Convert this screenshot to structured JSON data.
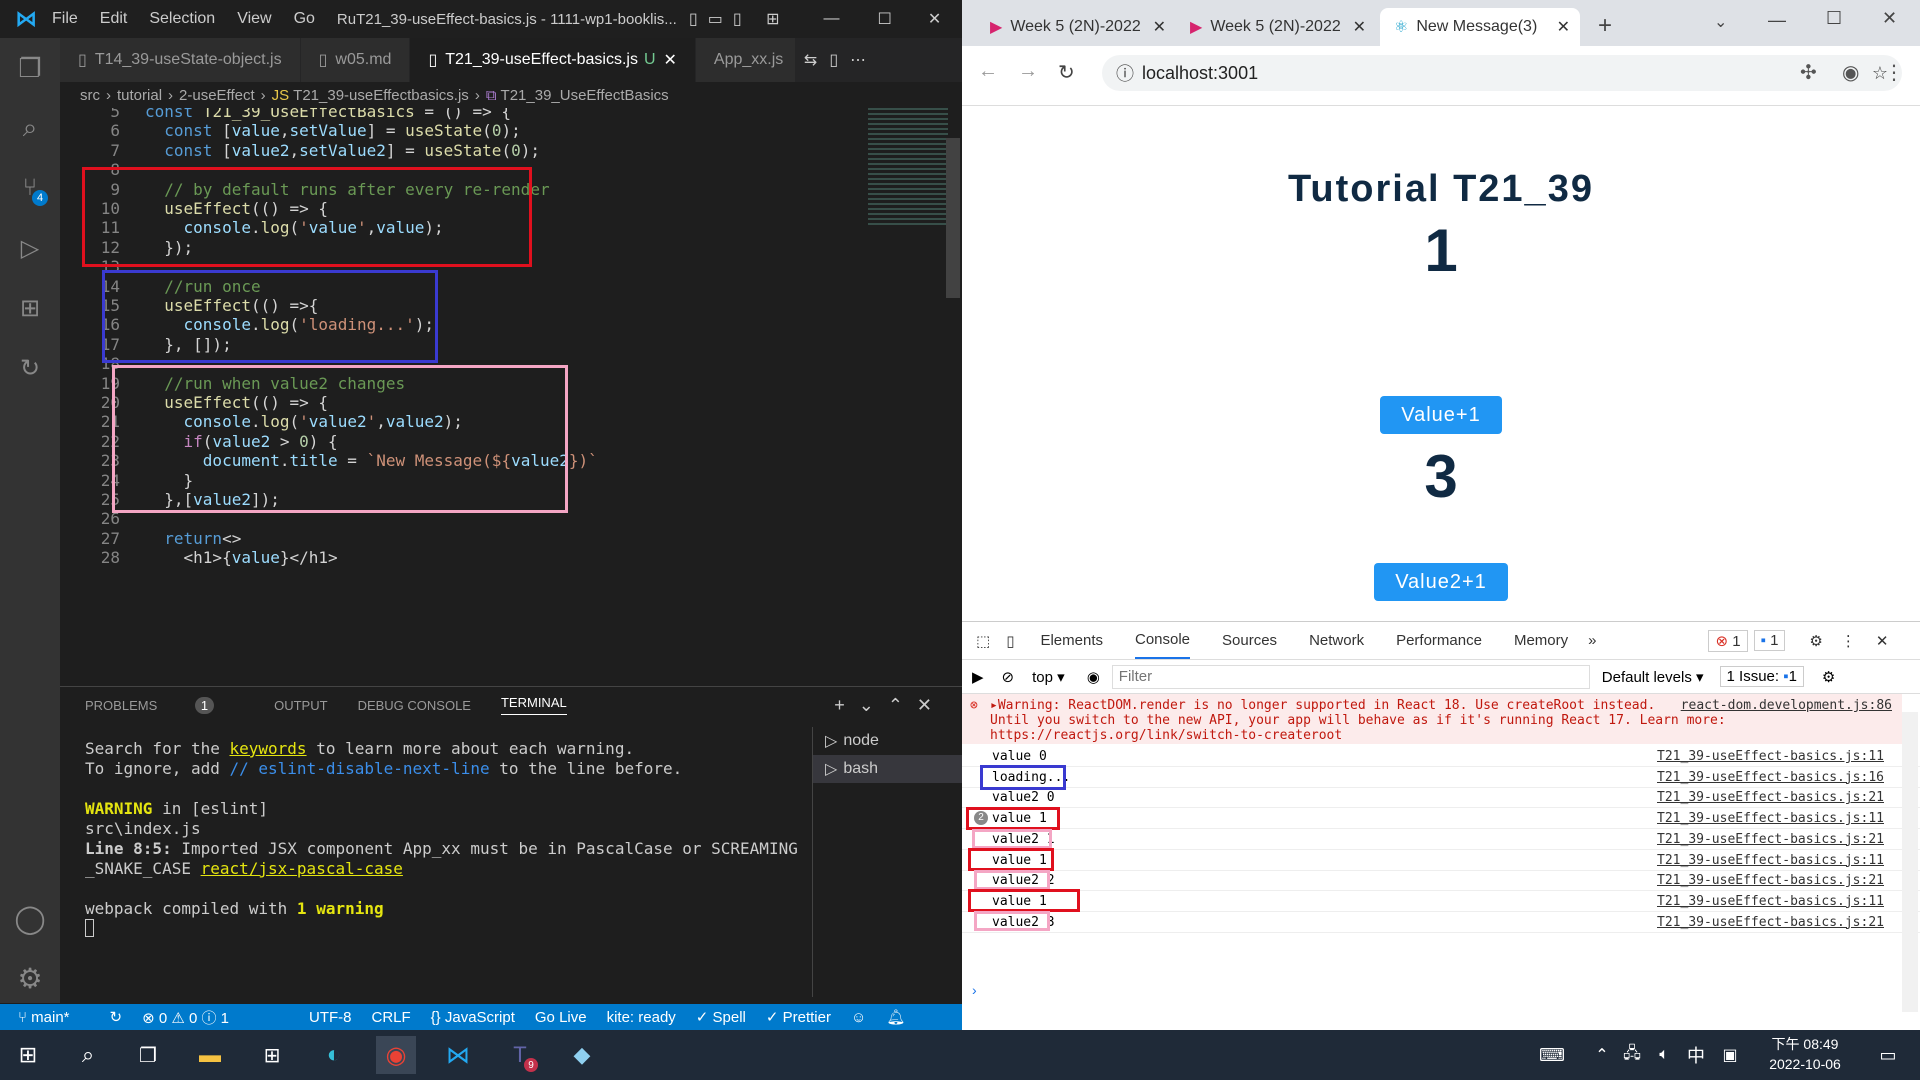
{
  "vscode": {
    "menu": [
      "File",
      "Edit",
      "Selection",
      "View",
      "Go"
    ],
    "title": "RuT21_39-useEffect-basics.js - 1111-wp1-booklis...",
    "tabs": [
      "T14_39-useState-object.js",
      "w05.md",
      "T21_39-useEffect-basics.js",
      "App_xx.js"
    ],
    "active_tab_marker": "U",
    "breadcrumb": [
      "src",
      "tutorial",
      "2-useEffect",
      "T21_39-useEffectbasics.js",
      "T21_39_UseEffectBasics"
    ],
    "badge_source_control": "4",
    "code": [
      {
        "n": "5",
        "t": "const T21_39_UseEffectBasics = () => {"
      },
      {
        "n": "6",
        "t": "  const [value,setValue] = useState(0);"
      },
      {
        "n": "7",
        "t": "  const [value2,setValue2] = useState(0);"
      },
      {
        "n": "8",
        "t": ""
      },
      {
        "n": "9",
        "t": "  // by default runs after every re-render"
      },
      {
        "n": "10",
        "t": "  useEffect(() => {"
      },
      {
        "n": "11",
        "t": "    console.log('value',value);"
      },
      {
        "n": "12",
        "t": "  });"
      },
      {
        "n": "13",
        "t": ""
      },
      {
        "n": "14",
        "t": "  //run once"
      },
      {
        "n": "15",
        "t": "  useEffect(() =>{"
      },
      {
        "n": "16",
        "t": "    console.log('loading...');"
      },
      {
        "n": "17",
        "t": "  }, []);"
      },
      {
        "n": "18",
        "t": ""
      },
      {
        "n": "19",
        "t": "  //run when value2 changes"
      },
      {
        "n": "20",
        "t": "  useEffect(() => {"
      },
      {
        "n": "21",
        "t": "    console.log('value2',value2);"
      },
      {
        "n": "22",
        "t": "    if(value2 > 0) {"
      },
      {
        "n": "23",
        "t": "      document.title = `New Message(${value2})`"
      },
      {
        "n": "24",
        "t": "    }"
      },
      {
        "n": "25",
        "t": "  },[value2]);"
      },
      {
        "n": "26",
        "t": ""
      },
      {
        "n": "27",
        "t": "  return<>"
      },
      {
        "n": "28",
        "t": "    <h1>{value}</h1>"
      }
    ],
    "panel_tabs": [
      "PROBLEMS",
      "OUTPUT",
      "DEBUG CONSOLE",
      "TERMINAL"
    ],
    "problems_count": "1",
    "terminal_lines": [
      "Search for the keywords to learn more about each warning.",
      "To ignore, add // eslint-disable-next-line to the line before.",
      "",
      "WARNING in [eslint]",
      "src\\index.js",
      "  Line 8:5:  Imported JSX component App_xx must be in PascalCase or SCREAMING",
      "_SNAKE_CASE  react/jsx-pascal-case",
      "",
      "webpack compiled with 1 warning"
    ],
    "terminal_sessions": [
      "node",
      "bash"
    ],
    "status": {
      "branch": "main*",
      "problems": "⊗ 0 ⚠ 0 ⓘ 1",
      "encoding": "UTF-8",
      "eol": "CRLF",
      "language": "{} JavaScript",
      "golive": "Go Live",
      "kite": "kite: ready",
      "spell": "✓ Spell",
      "prettier": "✓ Prettier"
    }
  },
  "chrome": {
    "tabs": [
      "Week 5 (2N)-2022",
      "Week 5 (2N)-2022",
      "New Message(3)"
    ],
    "url": "localhost:3001",
    "page_title": "Tutorial T21_39",
    "value": "1",
    "value_button": "Value+1",
    "value2": "3",
    "value2_button": "Value2+1",
    "devtools_tabs": [
      "Elements",
      "Console",
      "Sources",
      "Network",
      "Performance",
      "Memory"
    ],
    "error_count": "1",
    "message_count": "1",
    "context": "top",
    "filter_placeholder": "Filter",
    "levels": "Default levels ▾",
    "issues": "1 Issue:",
    "issues_count": "1",
    "warning_text": "▸Warning: ReactDOM.render is no longer supported in React 18. Use createRoot instead. Until you switch to the new API, your app will behave as if it's running React 17. Learn more: https://reactjs.org/link/switch-to-createroot",
    "warning_src": "react-dom.development.js:86",
    "console_rows": [
      {
        "msg": "value 0",
        "src": "T21_39-useEffect-basics.js:11"
      },
      {
        "msg": "loading...",
        "src": "T21_39-useEffect-basics.js:16"
      },
      {
        "msg": "value2 0",
        "src": "T21_39-useEffect-basics.js:21"
      },
      {
        "msg": "value 1",
        "src": "T21_39-useEffect-basics.js:11",
        "count": "2"
      },
      {
        "msg": "value2 1",
        "src": "T21_39-useEffect-basics.js:21"
      },
      {
        "msg": "value 1",
        "src": "T21_39-useEffect-basics.js:11"
      },
      {
        "msg": "value2 2",
        "src": "T21_39-useEffect-basics.js:21"
      },
      {
        "msg": "value 1",
        "src": "T21_39-useEffect-basics.js:11"
      },
      {
        "msg": "value2 3",
        "src": "T21_39-useEffect-basics.js:21"
      }
    ]
  },
  "taskbar": {
    "time": "下午 08:49",
    "date": "2022-10-06",
    "ime": "中",
    "teams_badge": "9"
  },
  "colors": {
    "accent_blue": "#007acc",
    "button_blue": "#2196f3",
    "highlight_red": "#e0101e",
    "highlight_blue": "#3a3ad0",
    "highlight_pink": "#f4a6c4"
  }
}
